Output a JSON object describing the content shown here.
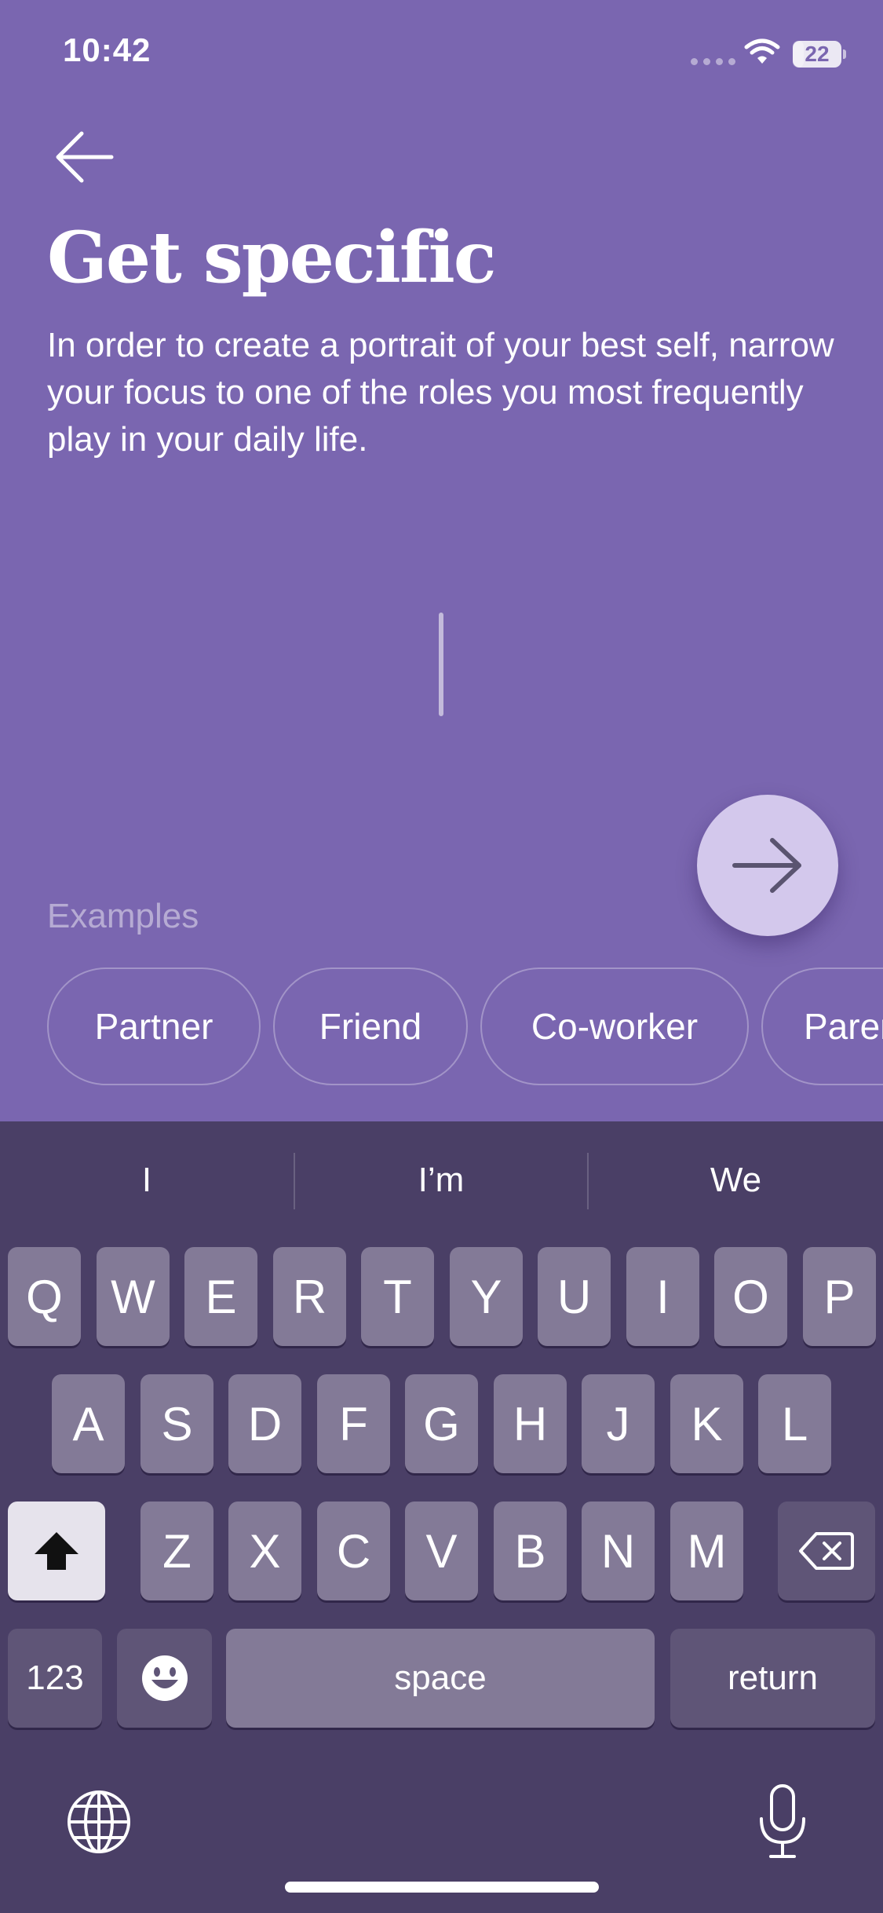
{
  "status_bar": {
    "time": "10:42",
    "battery_level": "22",
    "battery_fraction": 0.22
  },
  "header": {
    "title": "Get specific",
    "description": "In order to create a portrait of your best self, narrow your focus to one of the roles you most frequently play in your daily life."
  },
  "examples": {
    "label": "Examples",
    "chips": [
      "Partner",
      "Friend",
      "Co-worker",
      "Parent"
    ]
  },
  "keyboard": {
    "predictions": [
      "I",
      "I’m",
      "We"
    ],
    "row1": [
      "Q",
      "W",
      "E",
      "R",
      "T",
      "Y",
      "U",
      "I",
      "O",
      "P"
    ],
    "row2": [
      "A",
      "S",
      "D",
      "F",
      "G",
      "H",
      "J",
      "K",
      "L"
    ],
    "row3": [
      "Z",
      "X",
      "C",
      "V",
      "B",
      "N",
      "M"
    ],
    "numbers_label": "123",
    "space_label": "space",
    "return_label": "return"
  },
  "icons": {
    "back": "arrow-left-icon",
    "next": "arrow-right-icon",
    "shift": "shift-icon",
    "delete": "backspace-icon",
    "emoji": "emoji-icon",
    "globe": "globe-icon",
    "mic": "microphone-icon"
  },
  "colors": {
    "background": "#7a66b0",
    "next_button": "#d3c8ec",
    "keyboard": "#4a3f66"
  }
}
